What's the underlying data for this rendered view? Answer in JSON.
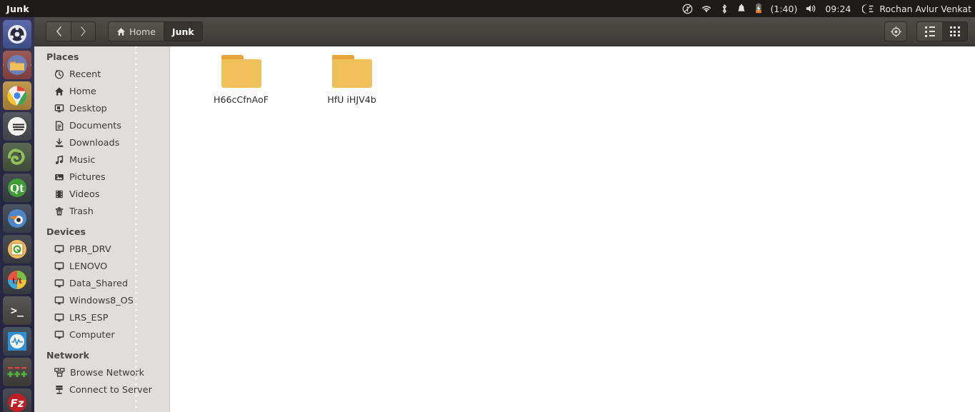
{
  "panel": {
    "window_title": "Junk",
    "tray": {
      "indicator_icon": "circle-slash-icon",
      "wifi_icon": "wifi-icon",
      "bluetooth_icon": "bluetooth-icon",
      "notification_icon": "bell-icon",
      "battery_icon": "battery-charging-icon",
      "battery_time": "(1:40)",
      "volume_icon": "volume-icon",
      "clock": "09:24",
      "session_icon": "session-menu-icon",
      "username": "Rochan Avlur Venkat"
    }
  },
  "launcher": {
    "items": [
      {
        "name": "ubuntu-dash",
        "label": "Dash",
        "running": false
      },
      {
        "name": "files-nautilus",
        "label": "Files",
        "running": true
      },
      {
        "name": "google-chrome",
        "label": "Google Chrome",
        "running": false
      },
      {
        "name": "eclipse",
        "label": "Eclipse",
        "running": false
      },
      {
        "name": "pycharm",
        "label": "PyCharm",
        "running": false
      },
      {
        "name": "qt-creator",
        "label": "Qt Creator",
        "running": false
      },
      {
        "name": "blender",
        "label": "Blender",
        "running": false
      },
      {
        "name": "qt-designer",
        "label": "Qt Designer",
        "running": false
      },
      {
        "name": "color-wheel-app",
        "label": "Color Wheel",
        "running": false
      },
      {
        "name": "terminal",
        "label": "Terminal",
        "running": false
      },
      {
        "name": "system-monitor",
        "label": "System Monitor",
        "running": false
      },
      {
        "name": "spreadsheet-app",
        "label": "Spreadsheet",
        "running": false
      },
      {
        "name": "filezilla",
        "label": "FileZilla",
        "running": false
      }
    ]
  },
  "toolbar": {
    "back_icon": "chevron-left-icon",
    "forward_icon": "chevron-right-icon",
    "breadcrumbs": [
      {
        "label": "Home",
        "icon": "home-icon",
        "active": false
      },
      {
        "label": "Junk",
        "icon": "",
        "active": true
      }
    ],
    "location_button_icon": "location-target-icon",
    "list_view_icon": "list-view-icon",
    "grid_view_icon": "grid-view-icon",
    "active_view": "grid"
  },
  "sidebar": {
    "sections": [
      {
        "title": "Places",
        "items": [
          {
            "label": "Recent",
            "icon": "clock-icon"
          },
          {
            "label": "Home",
            "icon": "home-icon"
          },
          {
            "label": "Desktop",
            "icon": "desktop-icon"
          },
          {
            "label": "Documents",
            "icon": "document-icon"
          },
          {
            "label": "Downloads",
            "icon": "download-icon"
          },
          {
            "label": "Music",
            "icon": "music-note-icon"
          },
          {
            "label": "Pictures",
            "icon": "picture-icon"
          },
          {
            "label": "Videos",
            "icon": "film-icon"
          },
          {
            "label": "Trash",
            "icon": "trash-icon"
          }
        ]
      },
      {
        "title": "Devices",
        "items": [
          {
            "label": "PBR_DRV",
            "icon": "drive-icon"
          },
          {
            "label": "LENOVO",
            "icon": "drive-icon"
          },
          {
            "label": "Data_Shared",
            "icon": "drive-icon"
          },
          {
            "label": "Windows8_OS",
            "icon": "drive-icon"
          },
          {
            "label": "LRS_ESP",
            "icon": "drive-icon"
          },
          {
            "label": "Computer",
            "icon": "drive-icon"
          }
        ]
      },
      {
        "title": "Network",
        "items": [
          {
            "label": "Browse Network",
            "icon": "network-icon"
          },
          {
            "label": "Connect to Server",
            "icon": "server-icon"
          }
        ]
      }
    ]
  },
  "content": {
    "files": [
      {
        "name": "H66cCfnAoF",
        "type": "folder",
        "icon": "folder-icon"
      },
      {
        "name": "HfU iHJV4b",
        "type": "folder",
        "icon": "folder-icon"
      }
    ]
  },
  "colors": {
    "panel_bg": "#1d1a18",
    "toolbar_bg": "#46443f",
    "sidebar_bg": "#e0dedb",
    "content_bg": "#ffffff",
    "folder_body": "#f0c05a",
    "folder_tab": "#e8a33b"
  }
}
